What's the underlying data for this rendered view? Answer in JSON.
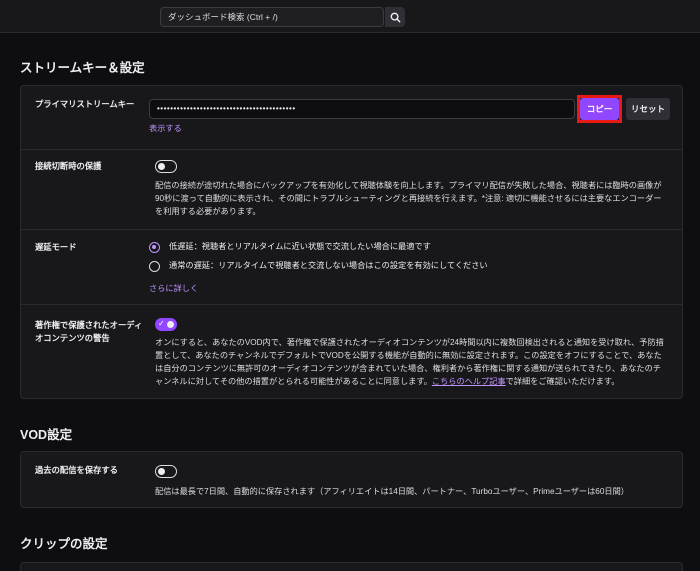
{
  "search": {
    "placeholder": "ダッシュボード検索 (Ctrl + /)"
  },
  "stream": {
    "section_title": "ストリームキー＆設定",
    "key": {
      "label": "プライマリストリームキー",
      "value": "••••••••••••••••••••••••••••••••••••••••••",
      "copy_label": "コピー",
      "reset_label": "リセット",
      "show_label": "表示する"
    },
    "disconnect": {
      "label": "接続切断時の保護",
      "description": "配信の接続が途切れた場合にバックアップを有効化して視聴体験を向上します。プライマリ配信が失敗した場合、視聴者には臨時の画像が90秒に渡って自動的に表示され、その間にトラブルシューティングと再接続を行えます。*注意: 適切に機能させるには主要なエンコーダーを利用する必要があります。",
      "enabled": false
    },
    "latency": {
      "label": "遅延モード",
      "options": [
        {
          "text": "低遅延：視聴者とリアルタイムに近い状態で交流したい場合に最適です",
          "selected": true
        },
        {
          "text": "通常の遅延：リアルタイムで視聴者と交流しない場合はこの設定を有効にしてください",
          "selected": false
        }
      ],
      "more_label": "さらに詳しく"
    },
    "copyright": {
      "label_line1": "著作権で保護されたオーディ",
      "label_line2": "オコンテンツの警告",
      "enabled": true,
      "description": "オンにすると、あなたのVOD内で、著作権で保護されたオーディオコンテンツが24時間以内に複数回検出されると通知を受け取れ、予防措置として、あなたのチャンネルでデフォルトでVODを公開する機能が自動的に無効に設定されます。この設定をオフにすることで、あなたは自分のコンテンツに無許可のオーディオコンテンツが含まれていた場合、権利者から著作権に関する通知が送られてきたり、あなたのチャンネルに対してその他の措置がとられる可能性があることに同意します。",
      "help_link": "こちらのヘルプ記事",
      "help_suffix": "で詳細をご確認いただけます。"
    }
  },
  "vod": {
    "section_title": "VOD設定",
    "store": {
      "label": "過去の配信を保存する",
      "enabled": false,
      "description": "配信は最長で7日間、自動的に保存されます（アフィリエイトは14日間、パートナー、Turboユーザー、Primeユーザーは60日間）"
    }
  },
  "clips": {
    "section_title": "クリップの設定"
  },
  "colors": {
    "accent": "#9147ff",
    "highlight": "#e91916",
    "background": "#0e0e10",
    "panel": "#18181b"
  }
}
